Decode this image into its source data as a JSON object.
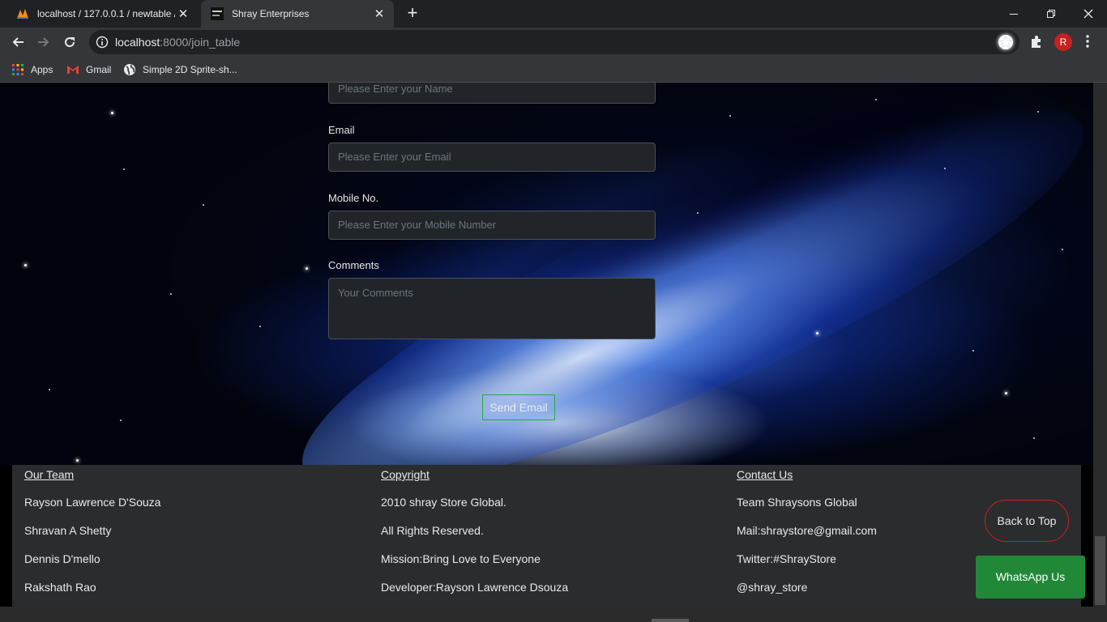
{
  "browser": {
    "tabs": [
      {
        "title": "localhost / 127.0.0.1 / newtable /",
        "icon": "phpmyadmin-icon"
      },
      {
        "title": "Shray Enterprises",
        "icon": "site-favicon"
      }
    ],
    "url_host": "localhost",
    "url_path": ":8000/join_table",
    "profile_initial": "R",
    "bookmarks": [
      {
        "label": "Apps",
        "icon": "apps-grid-icon"
      },
      {
        "label": "Gmail",
        "icon": "gmail-icon"
      },
      {
        "label": "Simple 2D Sprite-sh...",
        "icon": "globe-icon"
      }
    ]
  },
  "form": {
    "name_placeholder": "Please Enter your Name",
    "email_label": "Email",
    "email_placeholder": "Please Enter your Email",
    "mobile_label": "Mobile No.",
    "mobile_placeholder": "Please Enter your Mobile Number",
    "comments_label": "Comments",
    "comments_placeholder": "Your Comments",
    "send_label": "Send Email"
  },
  "footer": {
    "team": {
      "heading": "Our Team",
      "lines": [
        "Rayson Lawrence D'Souza",
        "Shravan A Shetty",
        "Dennis D'mello",
        "Rakshath Rao"
      ]
    },
    "copyright": {
      "heading": "Copyright",
      "lines": [
        "2010 shray Store Global.",
        "All Rights Reserved.",
        "Mission:Bring Love to Everyone",
        "Developer:Rayson Lawrence Dsouza"
      ]
    },
    "contact": {
      "heading": "Contact Us",
      "lines": [
        "Team Shraysons Global",
        "Mail:shraystore@gmail.com",
        "Twitter:#ShrayStore",
        "@shray_store"
      ]
    },
    "back_to_top": "Back to Top",
    "whatsapp": "WhatsApp Us"
  },
  "colors": {
    "send_border": "#28a745",
    "back_top_border": "#c5221f",
    "whatsapp_bg": "#218838",
    "avatar_bg": "#c5221f"
  }
}
